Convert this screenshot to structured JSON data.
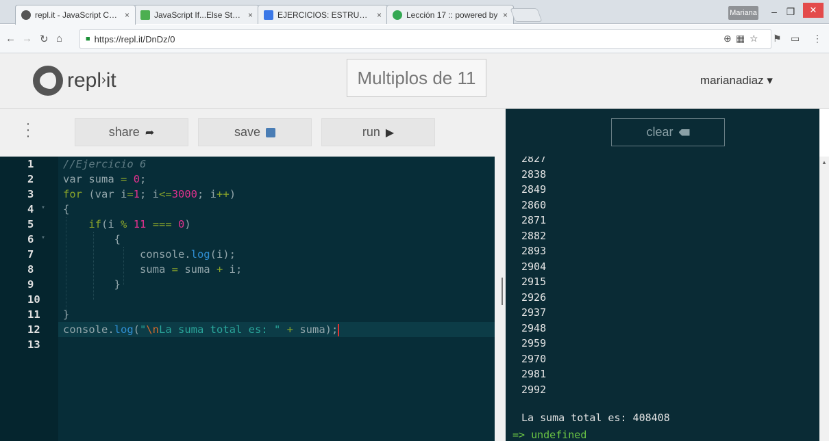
{
  "browser": {
    "tabs": [
      {
        "title": "repl.it - JavaScript Comp",
        "color": "#555"
      },
      {
        "title": "JavaScript If...Else Statem",
        "color": "#4caf50"
      },
      {
        "title": "EJERCICIOS: ESTRUCTUR",
        "color": "#3b78e7"
      },
      {
        "title": "Lección 17 :: powered by",
        "color": "#34a853"
      }
    ],
    "close_glyph": "×",
    "user_badge": "Mariana",
    "url": "https://repl.it/DnDz/0"
  },
  "header": {
    "logo_text": "repl",
    "logo_text_suffix": "it",
    "project_title": "Multiplos de 11",
    "username": "marianadiaz ▾"
  },
  "toolbar": {
    "share_label": "share",
    "save_label": "save",
    "run_label": "run",
    "clear_label": "clear"
  },
  "editor": {
    "line_numbers": [
      "1",
      "2",
      "3",
      "4",
      "5",
      "6",
      "7",
      "8",
      "9",
      "10",
      "11",
      "12",
      "13"
    ],
    "active_line": 12
  },
  "console": {
    "output_lines": [
      "2827",
      "2838",
      "2849",
      "2860",
      "2871",
      "2882",
      "2893",
      "2904",
      "2915",
      "2926",
      "2937",
      "2948",
      "2959",
      "2970",
      "2981",
      "2992"
    ],
    "sum_line": "La suma total es: 408408",
    "result_line": "=> undefined"
  },
  "colors": {
    "editor_bg": "#072d38",
    "console_bg": "#0a2b35",
    "keyword": "#8ba52a",
    "number": "#e0318d",
    "function": "#2f8fd4",
    "result": "#6cc644"
  }
}
